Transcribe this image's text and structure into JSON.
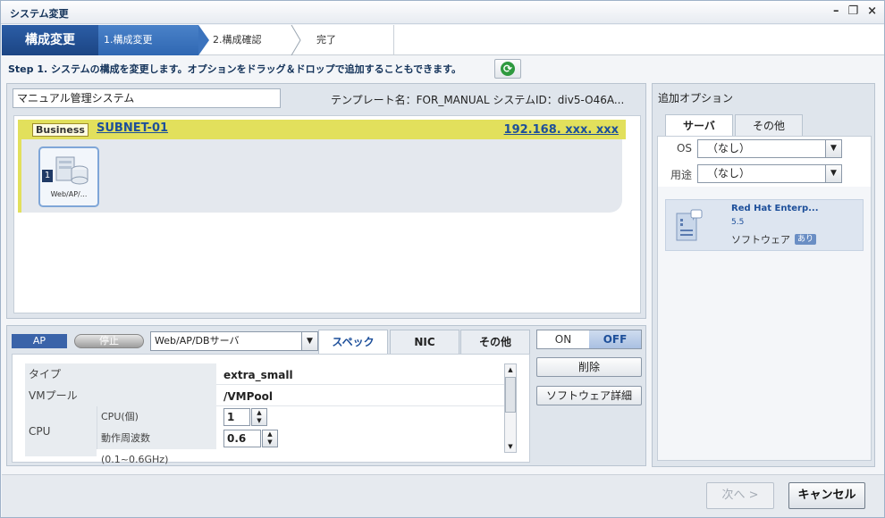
{
  "window": {
    "title": "システム変更",
    "controls": {
      "minimize": "–",
      "restore": "❐",
      "close": "×"
    }
  },
  "wizard": {
    "main_label": "構成変更",
    "steps": [
      {
        "label": "1.構成変更",
        "state": "active"
      },
      {
        "label": "2.構成確認",
        "state": "pending"
      },
      {
        "label": "完了",
        "state": "pending"
      }
    ]
  },
  "step_instruction": "Step 1. システムの構成を変更します。オプションをドラッグ＆ドロップで追加することもできます。",
  "system": {
    "name": "マニュアル管理システム",
    "template_info": "テンプレート名：FOR_MANUAL  システムID：div5-O46A..."
  },
  "subnet": {
    "badge": "Business",
    "name": "SUBNET-01",
    "ip": "192.168. xxx. xxx",
    "color": "#e2e05c"
  },
  "server_node": {
    "number": "1",
    "label": "Web/AP/..."
  },
  "options_panel": {
    "title": "追加オプション",
    "tabs": [
      {
        "label": "サーバ",
        "active": true
      },
      {
        "label": "その他",
        "active": false
      }
    ],
    "filters": [
      {
        "label": "OS",
        "value": "（なし）"
      },
      {
        "label": "用途",
        "value": "（なし）"
      }
    ],
    "software": {
      "name": "Red Hat Enterp...",
      "version": "5.5",
      "type": "ソフトウェア",
      "tag": "あり"
    }
  },
  "detail": {
    "role_badge": "AP",
    "status": "停止",
    "server_type": "Web/AP/DBサーバ",
    "tabs": [
      {
        "label": "スペック",
        "active": true
      },
      {
        "label": "NIC",
        "active": false
      },
      {
        "label": "その他",
        "active": false
      }
    ],
    "rows": [
      {
        "key": "タイプ",
        "value": "extra_small"
      },
      {
        "key": "VMプール",
        "value": "/VMPool"
      }
    ],
    "cpu": {
      "label": "CPU",
      "count_label": "CPU(個)",
      "count_value": "1",
      "freq_label": "動作周波数(0.1~0.6GHz)",
      "freq_value": "0.6"
    },
    "power": {
      "on": "ON",
      "off": "OFF",
      "selected": "OFF"
    },
    "buttons": {
      "delete": "削除",
      "software_detail": "ソフトウェア詳細"
    }
  },
  "footer": {
    "next": "次へ >",
    "cancel": "キャンセル"
  }
}
